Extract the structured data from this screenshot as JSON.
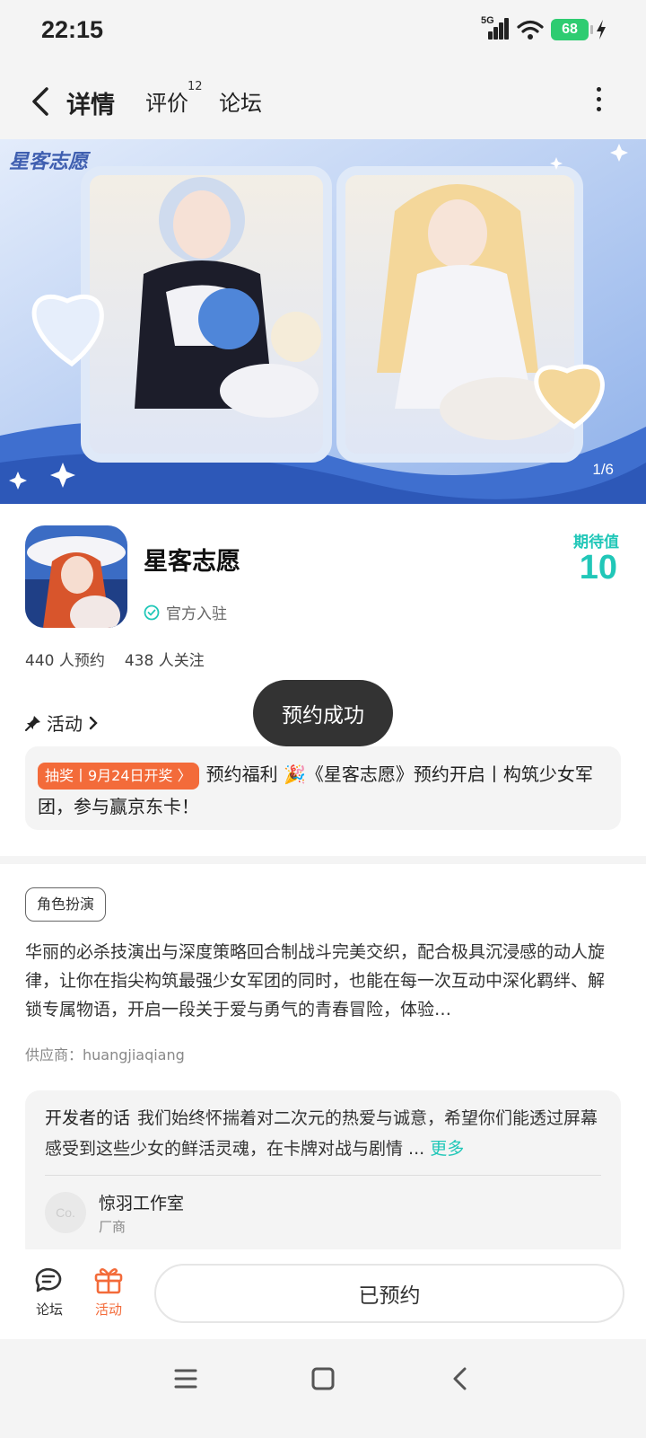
{
  "status_bar": {
    "time": "22:15",
    "network": "5G",
    "battery": "68"
  },
  "nav": {
    "tabs": [
      {
        "label": "详情",
        "active": true
      },
      {
        "label": "评价",
        "badge": "12"
      },
      {
        "label": "论坛"
      }
    ]
  },
  "banner": {
    "image_counter": "1/6",
    "logo_text": "星客志愿"
  },
  "app": {
    "name": "星客志愿",
    "verified_label": "官方入驻",
    "expectation_label": "期待值",
    "expectation_value": "10",
    "reservations": "440 人预约",
    "followers": "438 人关注"
  },
  "activity": {
    "header": "活动",
    "lottery_tag": "抽奖丨9月24日开奖 〉",
    "text": "预约福利 🎉《星客志愿》预约开启丨构筑少女军团，参与赢京东卡！"
  },
  "toast": "预约成功",
  "genre_tag": "角色扮演",
  "description": "华丽的必杀技演出与深度策略回合制战斗完美交织，配合极具沉浸感的动人旋律，让你在指尖构筑最强少女军团的同时，也能在每一次互动中深化羁绊、解锁专属物语，开启一段关于爱与勇气的青春冒险，体验…",
  "supplier": "供应商：huangjiaqiang",
  "developer": {
    "title": "开发者的话",
    "text": "我们始终怀揣着对二次元的热爱与诚意，希望你们能透过屏幕感受到这些少女的鲜活灵魂，在卡牌对战与剧情 ...",
    "more": "更多",
    "avatar_text": "Co.",
    "studio_name": "惊羽工作室",
    "studio_role": "厂商"
  },
  "bottom_bar": {
    "forum_label": "论坛",
    "activity_label": "活动",
    "reserve_button": "已预约"
  },
  "colors": {
    "accent": "#21c7b8",
    "orange": "#f36b3a"
  }
}
